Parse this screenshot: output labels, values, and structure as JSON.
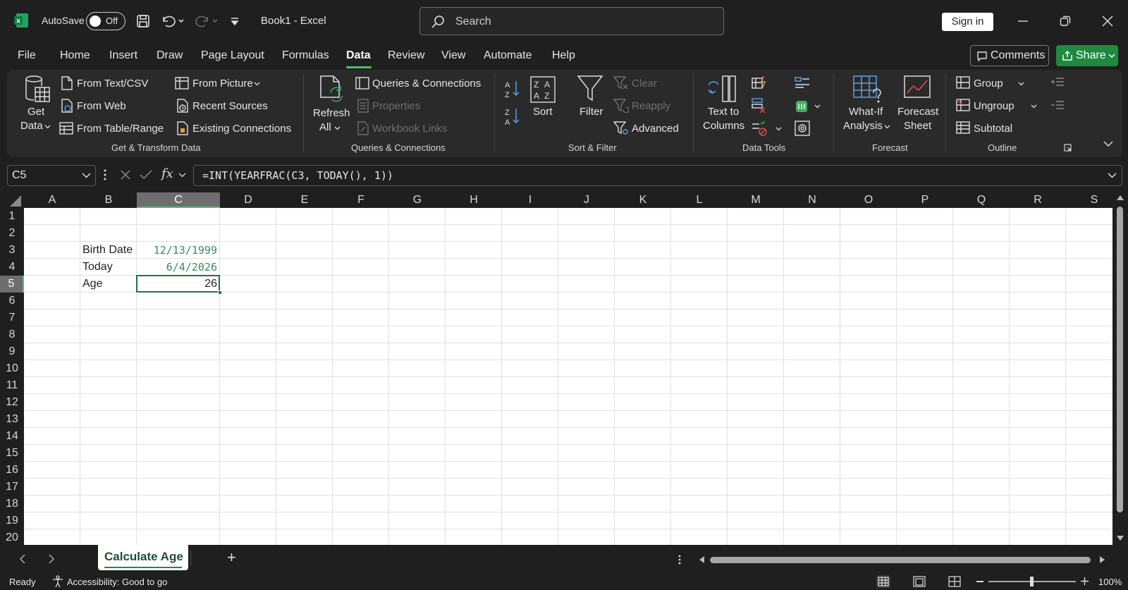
{
  "titlebar": {
    "autosave_label": "AutoSave",
    "autosave_state": "Off",
    "doc_title": "Book1  -  Excel",
    "search_placeholder": "Search",
    "signin_label": "Sign in"
  },
  "menu": {
    "items": [
      "File",
      "Home",
      "Insert",
      "Draw",
      "Page Layout",
      "Formulas",
      "Data",
      "Review",
      "View",
      "Automate",
      "Help"
    ],
    "active": "Data",
    "comments_label": "Comments",
    "share_label": "Share"
  },
  "ribbon": {
    "get_transform": {
      "get_data": [
        "Get",
        "Data"
      ],
      "from_text_csv": "From Text/CSV",
      "from_web": "From Web",
      "from_table_range": "From Table/Range",
      "from_picture": "From Picture",
      "recent_sources": "Recent Sources",
      "existing_connections": "Existing Connections",
      "group_label": "Get & Transform Data"
    },
    "queries": {
      "refresh_all": [
        "Refresh",
        "All"
      ],
      "queries_connections": "Queries & Connections",
      "properties": "Properties",
      "workbook_links": "Workbook Links",
      "group_label": "Queries & Connections"
    },
    "sort_filter": {
      "sort": "Sort",
      "filter": "Filter",
      "clear": "Clear",
      "reapply": "Reapply",
      "advanced": "Advanced",
      "group_label": "Sort & Filter"
    },
    "data_tools": {
      "text_to_columns": [
        "Text to",
        "Columns"
      ],
      "group_label": "Data Tools"
    },
    "forecast": {
      "what_if": [
        "What-If",
        "Analysis"
      ],
      "forecast_sheet": [
        "Forecast",
        "Sheet"
      ],
      "group_label": "Forecast"
    },
    "outline": {
      "group": "Group",
      "ungroup": "Ungroup",
      "subtotal": "Subtotal",
      "group_label": "Outline"
    }
  },
  "formula_bar": {
    "name_box": "C5",
    "formula": "=INT(YEARFRAC(C3, TODAY(), 1))",
    "fx_label": "fx"
  },
  "grid": {
    "columns": [
      "A",
      "B",
      "C",
      "D",
      "E",
      "F",
      "G",
      "H",
      "I",
      "J",
      "K",
      "L",
      "M",
      "N",
      "O",
      "P",
      "Q",
      "R",
      "S"
    ],
    "rows": [
      "1",
      "2",
      "3",
      "4",
      "5",
      "6",
      "7",
      "8",
      "9",
      "10",
      "11",
      "12",
      "13",
      "14",
      "15",
      "16",
      "17",
      "18",
      "19",
      "20"
    ],
    "selected_column": "C",
    "selected_row": "5",
    "cells": {
      "B3": "Birth Date",
      "C3": "12/13/1999",
      "B4": "Today",
      "C4": "6/4/2026",
      "B5": "Age",
      "C5": "26"
    }
  },
  "sheet_tabs": {
    "active": "Calculate Age",
    "add_label": "+"
  },
  "status": {
    "ready": "Ready",
    "accessibility": "Accessibility: Good to go",
    "zoom": "100%"
  },
  "colors": {
    "accent_green": "#1f8a3f",
    "date_text": "#3c8a5a",
    "selection_border": "#217346"
  }
}
